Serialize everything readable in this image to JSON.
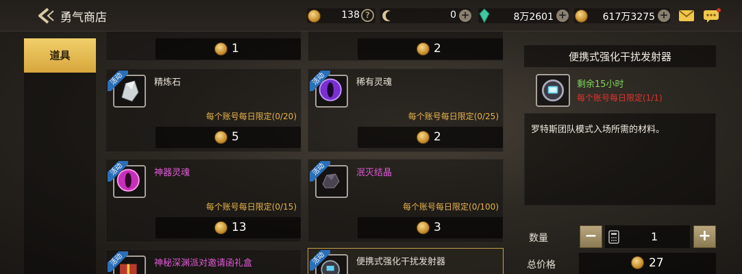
{
  "header": {
    "title": "勇气商店",
    "currencies": [
      {
        "icon": "gold-coin-icon",
        "value": "138"
      },
      {
        "icon": "crescent-token-icon",
        "value": "0"
      },
      {
        "icon": "green-crystal-icon",
        "value": "8万2601"
      },
      {
        "icon": "gold-coin-icon",
        "value": "617万3275"
      }
    ],
    "help_glyph": "?",
    "plus_glyph": "+"
  },
  "sidebar": {
    "tabs": [
      {
        "label": "道具",
        "selected": true
      }
    ]
  },
  "items": [
    {
      "name": "",
      "limit": "",
      "price": "1",
      "partial": true
    },
    {
      "name": "",
      "limit": "",
      "price": "2",
      "partial": true
    },
    {
      "name": "精炼石",
      "badge": "活动",
      "limit": "每个账号每日限定(0/20)",
      "price": "5",
      "name_color": "#e8e2d6",
      "icon": "refining-stone-icon"
    },
    {
      "name": "稀有灵魂",
      "badge": "活动",
      "limit": "每个账号每日限定(0/25)",
      "price": "2",
      "name_color": "#e8e2d6",
      "icon": "rare-soul-icon"
    },
    {
      "name": "神器灵魂",
      "badge": "活动",
      "limit": "每个账号每日限定(0/15)",
      "price": "13",
      "name_color": "#e05ad6",
      "icon": "artifact-soul-icon"
    },
    {
      "name": "泯灭结晶",
      "badge": "活动",
      "limit": "每个账号每日限定(0/100)",
      "price": "3",
      "name_color": "#e05ad6",
      "icon": "annihilation-crystal-icon"
    },
    {
      "name": "神秘深渊派对邀请函礼盒",
      "badge": "活动",
      "name_color": "#e05ad6",
      "icon": "gift-box-icon"
    },
    {
      "name": "便携式强化干扰发射器",
      "badge": "活动",
      "name_color": "#e8e2d6",
      "icon": "jammer-device-icon",
      "selected": true
    }
  ],
  "detail": {
    "title": "便携式强化干扰发射器",
    "remaining": "剩余15小时",
    "limit": "每个账号每日限定(1/1)",
    "description": "罗特斯团队模式入场所需的材料。",
    "quantity_label": "数量",
    "quantity": "1",
    "minus_glyph": "−",
    "plus_glyph": "+",
    "total_label": "总价格",
    "total": "27"
  },
  "colors": {
    "accent_gold": "#d7a73c",
    "limit_orange": "#e7b24a",
    "remaining_green": "#7fd65a",
    "limit_red": "#e0352c",
    "badge_blue": "#2a6fb8"
  }
}
